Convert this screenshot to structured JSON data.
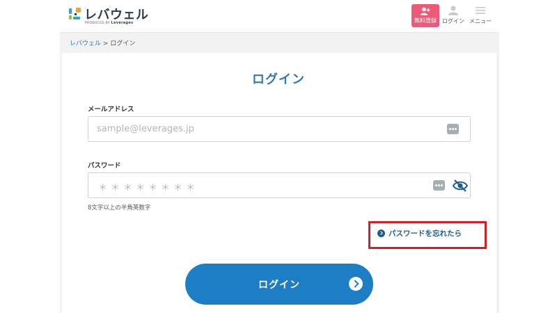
{
  "brand": {
    "name": "レバウェル",
    "produced_by": "PRODUCED BY",
    "company": "Leverages",
    "colors": {
      "accent": "#2f78b8",
      "button": "#1d7ec5",
      "signup": "#ec5a78",
      "highlight": "#d81e25"
    }
  },
  "header": {
    "signup_label": "無料登録",
    "login_label": "ログイン",
    "menu_label": "メニュー"
  },
  "breadcrumb": {
    "home": "レバウェル",
    "separator": ">",
    "current": "ログイン"
  },
  "form": {
    "title": "ログイン",
    "email": {
      "label": "メールアドレス",
      "placeholder": "sample@leverages.jp",
      "value": ""
    },
    "password": {
      "label": "パスワード",
      "placeholder": "＊＊＊＊＊＊＊＊",
      "hint": "8文字以上の半角英数字"
    },
    "forgot_link": "パスワードを忘れたら",
    "submit_label": "ログイン"
  },
  "icons": {
    "signup": "user-plus-icon",
    "login": "user-icon",
    "menu": "hamburger-icon",
    "autofill": "dots-icon",
    "visibility": "eye-off-icon"
  }
}
